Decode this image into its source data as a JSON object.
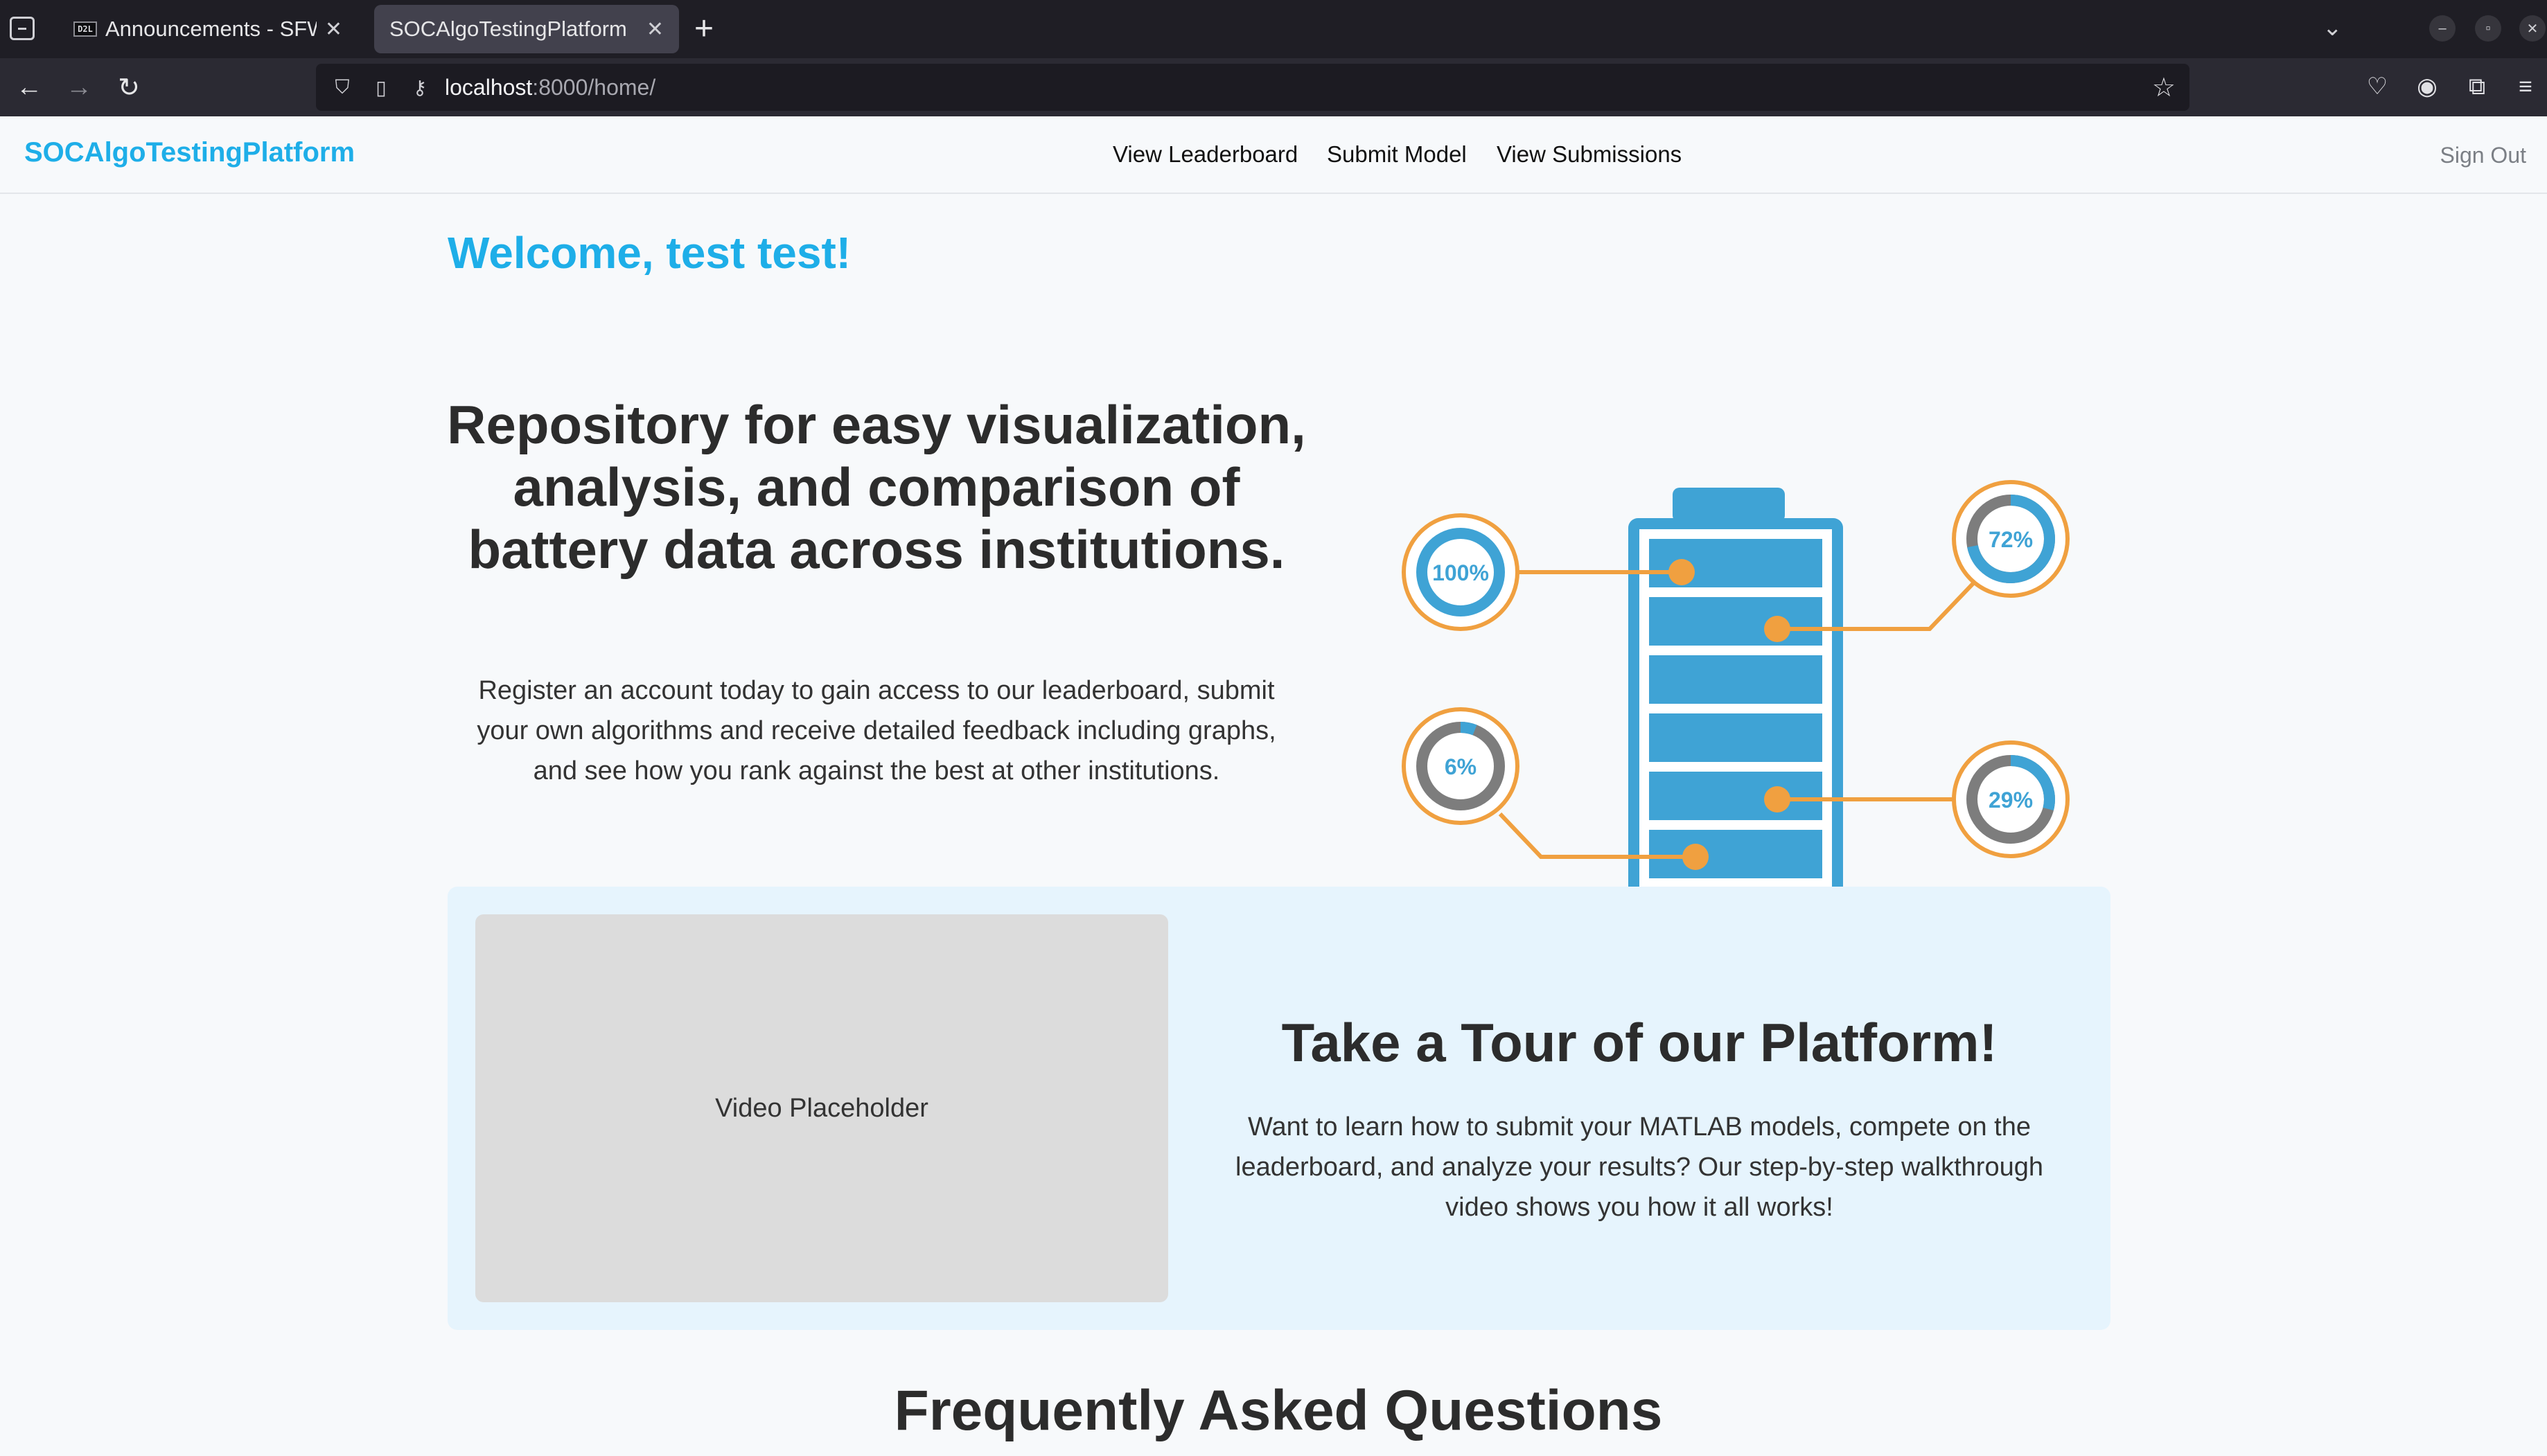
{
  "browser": {
    "tabs": [
      {
        "favicon": "D2L",
        "title": "Announcements - SFWRE",
        "active": false
      },
      {
        "favicon": "",
        "title": "SOCAlgoTestingPlatform",
        "active": true
      }
    ],
    "url_host": "localhost",
    "url_rest": ":8000/home/"
  },
  "site": {
    "brand": "SOCAlgoTestingPlatform",
    "nav": [
      "View Leaderboard",
      "Submit Model",
      "View Submissions"
    ],
    "signout": "Sign Out"
  },
  "welcome": "Welcome, test test!",
  "hero": {
    "title": "Repository for easy visualization, analysis, and comparison of battery data across institutions.",
    "text": "Register an account today to gain access to our leaderboard, submit your own algorithms and receive detailed feedback including graphs, and see how you rank against the best at other institutions.",
    "gauges": [
      {
        "label": "100%",
        "value": 1.0
      },
      {
        "label": "72%",
        "value": 0.72
      },
      {
        "label": "6%",
        "value": 0.06
      },
      {
        "label": "29%",
        "value": 0.29
      }
    ],
    "colors": {
      "battery": "#3fa3d5",
      "connector": "#f0a040",
      "gauge_track": "#7d7d7d"
    }
  },
  "tour": {
    "video_label": "Video Placeholder",
    "title": "Take a Tour of our Platform!",
    "text": "Want to learn how to submit your MATLAB models, compete on the leaderboard, and analyze your results? Our step-by-step walkthrough video shows you how it all works!"
  },
  "faq_title": "Frequently Asked Questions"
}
